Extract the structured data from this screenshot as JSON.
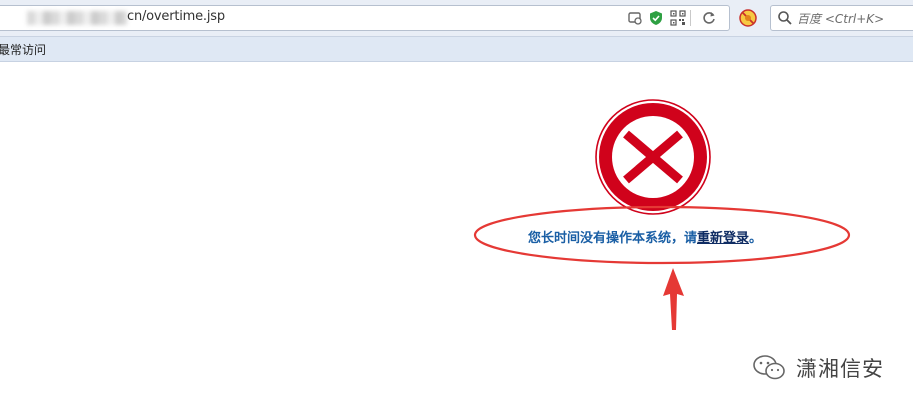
{
  "toolbar": {
    "url_visible": "cn/overtime.jsp",
    "search_placeholder": "百度 <Ctrl+K>",
    "icons": [
      "page-info-icon",
      "shield-check-icon",
      "qr-code-icon",
      "reload-icon",
      "extension-icon",
      "search-icon"
    ],
    "accent_shield": "#2ea043"
  },
  "bookmarks": {
    "items": [
      {
        "label": "最常访问"
      }
    ]
  },
  "main": {
    "message_prefix": "您长时间没有操作本系统，请",
    "relogin_link": "重新登录",
    "message_suffix": "。",
    "stop_color": "#d0021b",
    "annotation_color": "#e53935"
  },
  "watermark": {
    "text": "潇湘信安"
  }
}
